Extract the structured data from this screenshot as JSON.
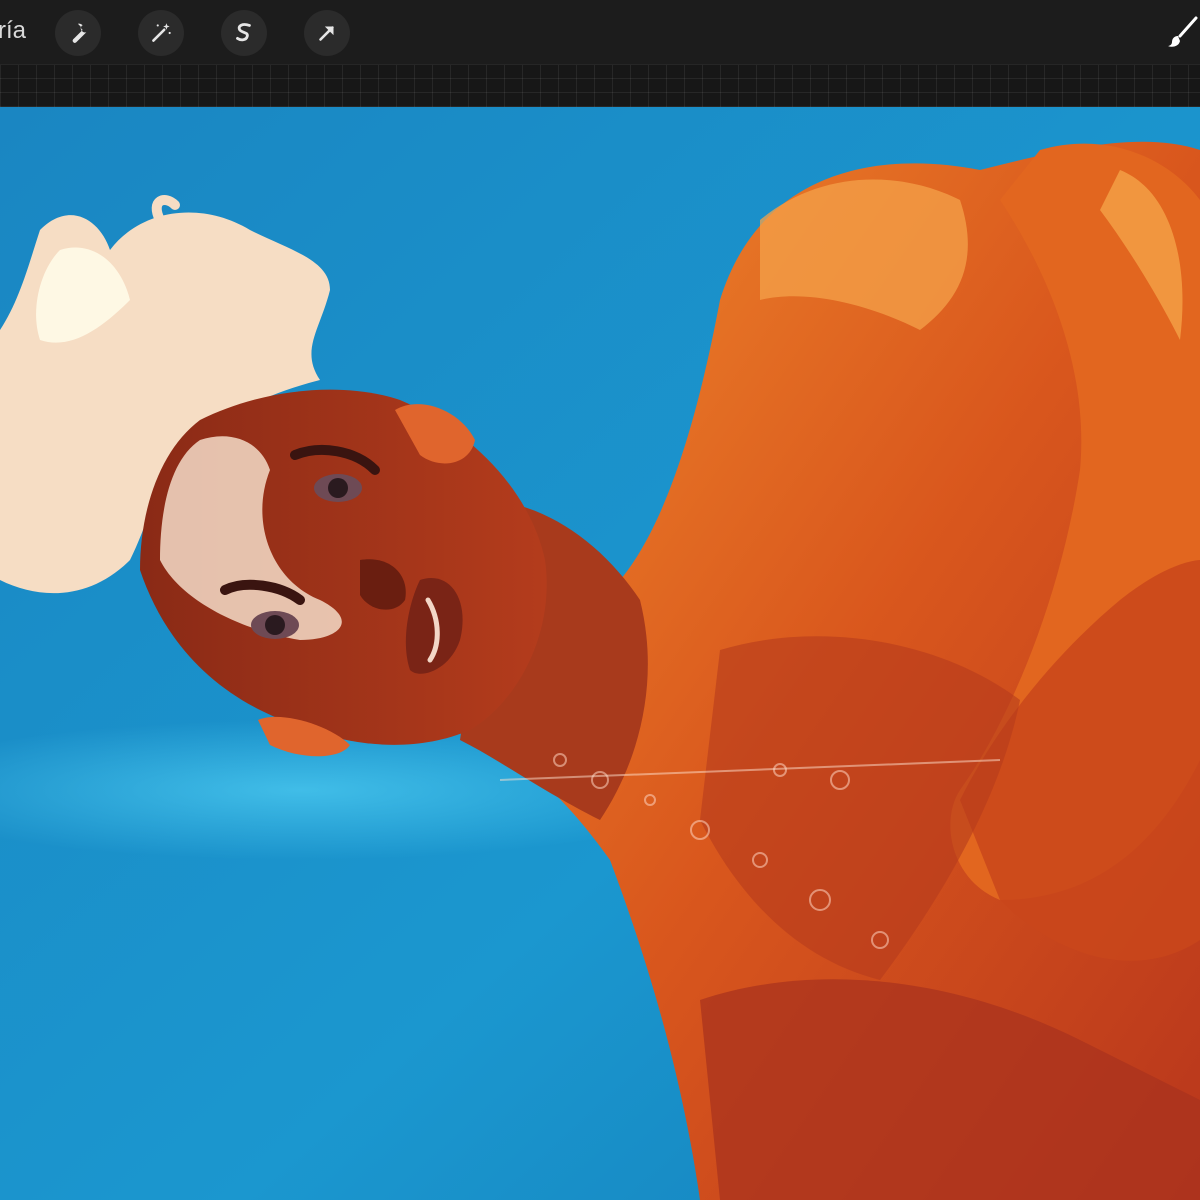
{
  "toolbar": {
    "gallery_label": "ría",
    "tools": [
      {
        "name": "actions",
        "icon": "wrench-icon"
      },
      {
        "name": "adjustments",
        "icon": "magic-wand-icon"
      },
      {
        "name": "selection",
        "icon": "selection-s-icon"
      },
      {
        "name": "transform",
        "icon": "arrow-cursor-icon"
      }
    ],
    "right_tools": [
      {
        "name": "brush",
        "icon": "brush-icon"
      }
    ]
  },
  "canvas": {
    "background_color": "#1a8fc7",
    "skin_color": "#d8561c",
    "hair_color": "#f4dcc0"
  }
}
